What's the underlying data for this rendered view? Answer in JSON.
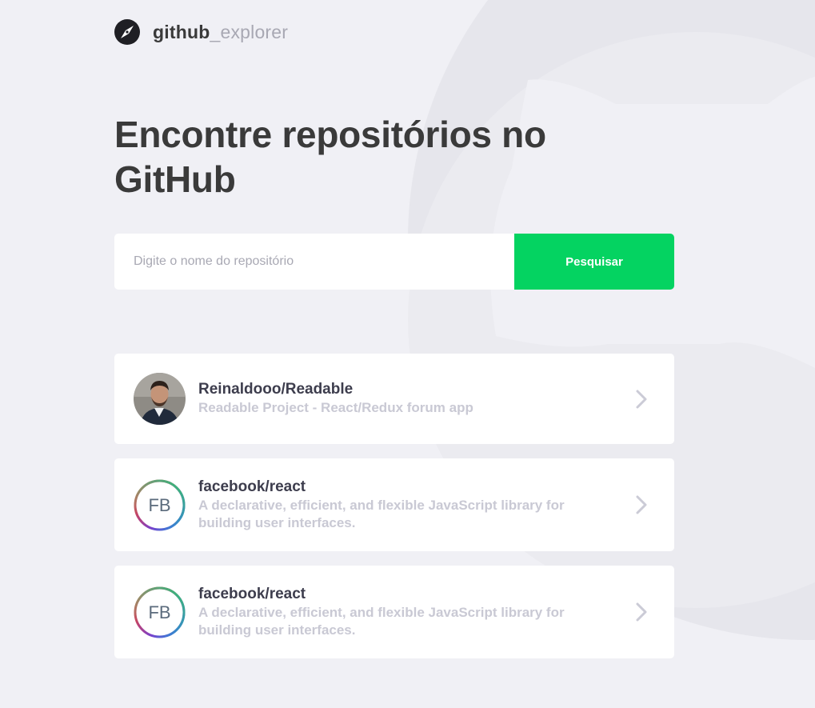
{
  "header": {
    "logo_part1": "github",
    "logo_separator": "_",
    "logo_part2": "explorer",
    "logo_icon": "compass-icon"
  },
  "page_title": "Encontre repositórios no GitHub",
  "search": {
    "placeholder": "Digite o nome do repositório",
    "value": "",
    "button_label": "Pesquisar"
  },
  "repositories": [
    {
      "full_name": "Reinaldooo/Readable",
      "description": "Readable Project - React/Redux forum app",
      "avatar": "user-photo-avatar"
    },
    {
      "full_name": "facebook/react",
      "description": "A declarative, efficient, and flexible JavaScript library for building user interfaces.",
      "avatar": "fb-logo-avatar",
      "avatar_text": "FB"
    },
    {
      "full_name": "facebook/react",
      "description": "A declarative, efficient, and flexible JavaScript library for building user interfaces.",
      "avatar": "fb-logo-avatar",
      "avatar_text": "FB"
    }
  ],
  "colors": {
    "background": "#f0f0f5",
    "accent": "#04d361",
    "title": "#3a3a3a",
    "muted": "#a8a8b3",
    "description": "#c9c9d4"
  }
}
